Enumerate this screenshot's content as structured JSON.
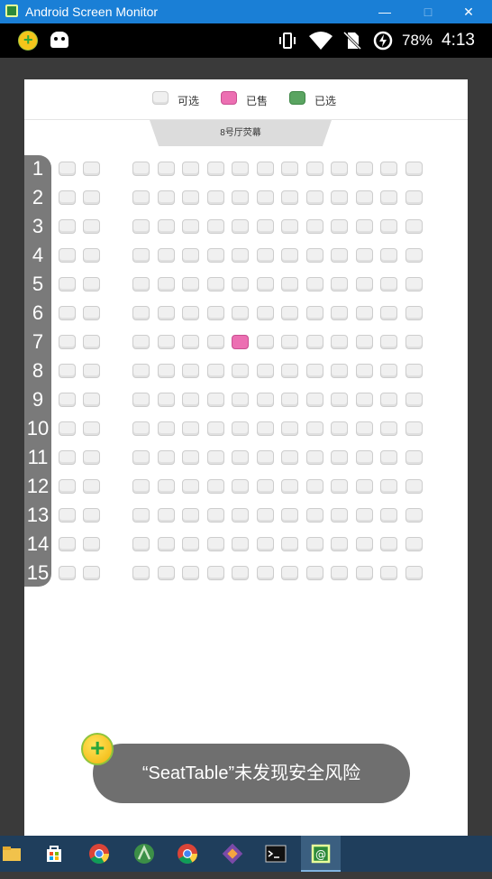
{
  "window": {
    "title": "Android Screen Monitor",
    "minimize": "—",
    "maximize": "□",
    "close": "✕"
  },
  "status_bar": {
    "battery": "78%",
    "time": "4:13"
  },
  "legend": [
    {
      "label": "可选",
      "color": "#f0f0f0"
    },
    {
      "label": "已售",
      "color": "#ec6fb2"
    },
    {
      "label": "已选",
      "color": "#5aa461"
    }
  ],
  "screen": {
    "label": "8号厅荧幕"
  },
  "seat_map": {
    "rows": [
      "1",
      "2",
      "3",
      "4",
      "5",
      "6",
      "7",
      "8",
      "9",
      "10",
      "11",
      "12",
      "13",
      "14",
      "15"
    ],
    "seats_per_row": 13,
    "sold": [
      {
        "row": 7,
        "seat": 6
      }
    ],
    "selected": []
  },
  "toast": {
    "message": "“SeatTable”未发现安全风险"
  },
  "taskbar": {
    "items": [
      "file-explorer-icon",
      "store-icon",
      "chrome-icon",
      "android-studio-icon",
      "chrome-icon",
      "git-icon",
      "terminal-icon",
      "screen-monitor-icon"
    ]
  }
}
